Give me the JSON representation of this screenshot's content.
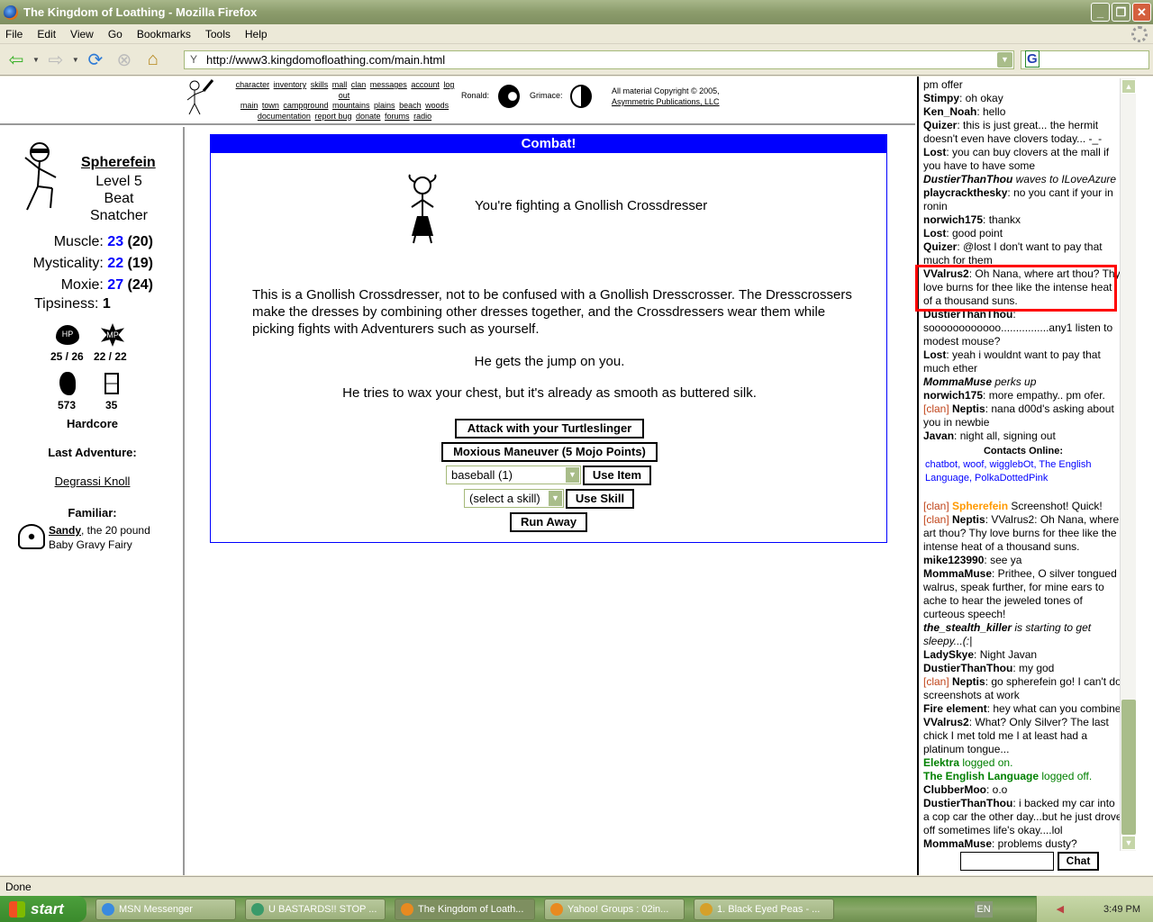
{
  "window": {
    "title": "The Kingdom of Loathing - Mozilla Firefox",
    "menu": [
      "File",
      "Edit",
      "View",
      "Go",
      "Bookmarks",
      "Tools",
      "Help"
    ],
    "url": "http://www3.kingdomofloathing.com/main.html",
    "status": "Done"
  },
  "topnav": {
    "row1": [
      "character",
      "inventory",
      "skills",
      "mall",
      "clan",
      "messages",
      "account",
      "log out"
    ],
    "row2": [
      "main",
      "town",
      "campground",
      "mountains",
      "plains",
      "beach",
      "woods"
    ],
    "row3": [
      "documentation",
      "report bug",
      "donate",
      "forums",
      "radio"
    ],
    "ronald_label": "Ronald:",
    "grimace_label": "Grimace:",
    "copyright": "All material Copyright © 2005,",
    "publisher": "Asymmetric Publications, LLC"
  },
  "character": {
    "name": "Spherefein",
    "level": "Level 5",
    "title": "Beat Snatcher",
    "stats": [
      {
        "label": "Muscle:",
        "buffed": "23",
        "base": "(20)"
      },
      {
        "label": "Mysticality:",
        "buffed": "22",
        "base": "(19)"
      },
      {
        "label": "Moxie:",
        "buffed": "27",
        "base": "(24)"
      }
    ],
    "tipsiness_label": "Tipsiness:",
    "tipsiness": "1",
    "hp": "25 / 26",
    "mp": "22 / 22",
    "hp_icon_label": "HP",
    "mp_icon_label": "MP",
    "meat": "573",
    "adventures": "35",
    "mode": "Hardcore",
    "last_adventure_label": "Last Adventure:",
    "last_adventure": "Degrassi Knoll",
    "familiar_label": "Familiar:",
    "familiar_name": "Sandy",
    "familiar_desc": ", the 20 pound",
    "familiar_type": "Baby Gravy Fairy"
  },
  "combat": {
    "header": "Combat!",
    "fighting": "You're fighting a Gnollish Crossdresser",
    "description": "This is a Gnollish Crossdresser, not to be confused with a Gnollish Dresscrosser. The Dresscrossers make the dresses by combining other dresses together, and the Crossdressers wear them while picking fights with Adventurers such as yourself.",
    "line1": "He gets the jump on you.",
    "line2": "He tries to wax your chest, but it's already as smooth as buttered silk.",
    "attack_button": "Attack with your Turtleslinger",
    "skill_button_1": "Moxious Maneuver (5 Mojo Points)",
    "item_select": "baseball (1)",
    "use_item_button": "Use Item",
    "skill_select": "(select a skill)",
    "use_skill_button": "Use Skill",
    "run_button": "Run Away"
  },
  "chat": {
    "messages": [
      {
        "name": "",
        "text": "pm offer"
      },
      {
        "name": "Stimpy",
        "text": ": oh okay"
      },
      {
        "name": "Ken_Noah",
        "text": ": hello"
      },
      {
        "name": "Quizer",
        "text": ": this is just great... the hermit doesn't even have clovers today... -_-"
      },
      {
        "name": "Lost",
        "text": ": you can buy clovers at the mall if you have to have some"
      },
      {
        "name": "DustierThanThou",
        "text": " waves to ILoveAzure",
        "emote": true
      },
      {
        "name": "playcrackthesky",
        "text": ": no you cant if your in ronin"
      },
      {
        "name": "norwich175",
        "text": ": thankx"
      },
      {
        "name": "Lost",
        "text": ": good point"
      },
      {
        "name": "Quizer",
        "text": ": @lost I don't want to pay that much for them"
      },
      {
        "name": "VValrus2",
        "text": ": Oh Nana, where art thou? Thy love burns for thee like the intense heat of a thousand suns."
      },
      {
        "name": "DustierThanThou",
        "text": ": soooooooooooo................any1 listen to modest mouse?"
      },
      {
        "name": "Lost",
        "text": ": yeah i wouldnt want to pay that much ether"
      },
      {
        "name": "MommaMuse",
        "text": " perks up",
        "emote": true
      },
      {
        "name": "norwich175",
        "text": ": more empathy.. pm ofer."
      },
      {
        "clan": "[clan]",
        "name": "Neptis",
        "text": ": nana d00d's asking about you in newbie"
      },
      {
        "name": "Javan",
        "text": ": night all, signing out"
      }
    ],
    "contacts_label": "Contacts Online:",
    "contacts": "chatbot, woof, wigglebOt, The English Language, PolkaDottedPink",
    "messages2": [
      {
        "clan": "[clan]",
        "name": "Spherefein",
        "text": " Screenshot! Quick!",
        "self": true
      },
      {
        "clan": "[clan]",
        "name": "Neptis",
        "text": ": VValrus2: Oh Nana, where art thou? Thy love burns for thee like the intense heat of a thousand suns."
      },
      {
        "name": "mike123990",
        "text": ": see ya"
      },
      {
        "name": "MommaMuse",
        "text": ": Prithee, O silver tongued walrus, speak further, for mine ears to ache to hear the jeweled tones of curteous speech!"
      },
      {
        "name": "the_stealth_killer",
        "text": " is starting to get sleepy...(:|",
        "emote": true
      },
      {
        "name": "LadySkye",
        "text": ": Night Javan"
      },
      {
        "name": "DustierThanThou",
        "text": ": my god"
      },
      {
        "clan": "[clan]",
        "name": "Neptis",
        "text": ": go spherefein go! I can't do screenshots at work"
      },
      {
        "name": "Fire element",
        "text": ": hey what can you combine"
      },
      {
        "name": "VValrus2",
        "text": ": What? Only Silver? The last chick I met told me I at least had a platinum tongue..."
      },
      {
        "name": "Elektra",
        "text": " logged on.",
        "system": true
      },
      {
        "name": "The English Language",
        "text": " logged off.",
        "system": true
      },
      {
        "name": "ClubberMoo",
        "text": ": o.o"
      },
      {
        "name": "DustierThanThou",
        "text": ": i backed my car into a cop car the other day...but he just drove off sometimes life's okay....lol"
      },
      {
        "name": "MommaMuse",
        "text": ": problems dusty?"
      }
    ],
    "chat_button": "Chat",
    "input_value": ""
  },
  "taskbar": {
    "start": "start",
    "tasks": [
      "MSN Messenger",
      "U BASTARDS!! STOP ...",
      "The Kingdom of Loath...",
      "Yahoo! Groups : 02in...",
      "1. Black Eyed Peas - ..."
    ],
    "language": "EN",
    "clock": "3:49 PM"
  }
}
